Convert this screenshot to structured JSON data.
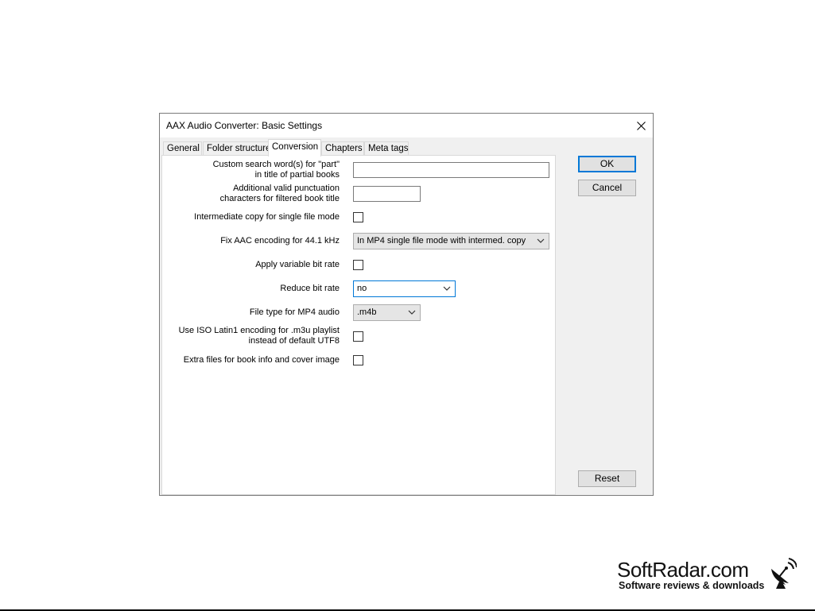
{
  "dialog": {
    "title": "AAX Audio Converter: Basic Settings"
  },
  "tabs": [
    {
      "label": "General",
      "active": false
    },
    {
      "label": "Folder structure",
      "active": false
    },
    {
      "label": "Conversion",
      "active": true
    },
    {
      "label": "Chapters",
      "active": false
    },
    {
      "label": "Meta tags",
      "active": false
    }
  ],
  "form": {
    "custom_search": {
      "label_line1": "Custom search word(s) for \"part\"",
      "label_line2": "in title of partial books",
      "value": ""
    },
    "punctuation": {
      "label_line1": "Additional valid punctuation",
      "label_line2": "characters for filtered book title",
      "value": ""
    },
    "intermediate_copy": {
      "label": "Intermediate copy for single file mode",
      "checked": false
    },
    "fix_aac": {
      "label": "Fix AAC encoding for 44.1 kHz",
      "value": "In MP4 single file mode with intermed. copy"
    },
    "variable_bitrate": {
      "label": "Apply variable bit rate",
      "checked": false
    },
    "reduce_bitrate": {
      "label": "Reduce bit rate",
      "value": "no"
    },
    "file_type": {
      "label": "File type for MP4 audio",
      "value": ".m4b"
    },
    "iso_latin": {
      "label_line1": "Use ISO Latin1 encoding for .m3u playlist",
      "label_line2": "instead of default UTF8",
      "checked": false
    },
    "extra_files": {
      "label": "Extra files for book info and cover image",
      "checked": false
    }
  },
  "buttons": {
    "ok": "OK",
    "cancel": "Cancel",
    "reset": "Reset"
  },
  "watermark": {
    "brand": "SoftRadar.com",
    "tagline": "Software reviews & downloads"
  },
  "icons": {
    "close": "close-icon",
    "dropdown": "chevron-down-icon",
    "logo": "satellite-dish-icon"
  },
  "colors": {
    "focus_border": "#0078d7",
    "dialog_bg": "#f0f0f0",
    "panel_bg": "#ffffff"
  }
}
